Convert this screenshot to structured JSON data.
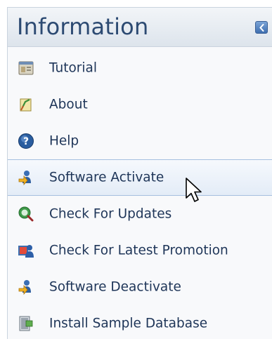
{
  "panel": {
    "title": "Information",
    "items": [
      {
        "label": "Tutorial",
        "icon": "tutorial-icon"
      },
      {
        "label": "About",
        "icon": "about-icon"
      },
      {
        "label": "Help",
        "icon": "help-icon"
      },
      {
        "label": "Software Activate",
        "icon": "activate-icon"
      },
      {
        "label": "Check For Updates",
        "icon": "updates-icon"
      },
      {
        "label": "Check For Latest Promotion",
        "icon": "promotion-icon"
      },
      {
        "label": "Software Deactivate",
        "icon": "deactivate-icon"
      },
      {
        "label": "Install Sample Database",
        "icon": "database-icon"
      }
    ],
    "active_item": "Software Activate"
  },
  "colors": {
    "header_text": "#2c4a72",
    "item_text": "#1e3558",
    "active_border": "#a5bfdf"
  }
}
